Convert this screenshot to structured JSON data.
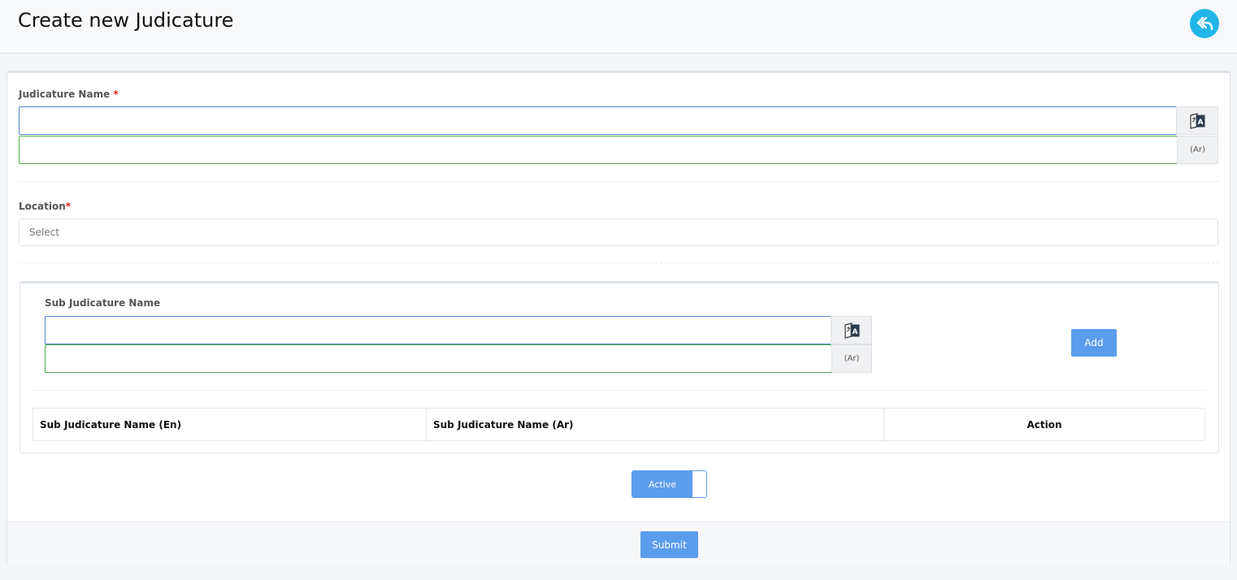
{
  "header": {
    "title": "Create new Judicature"
  },
  "form": {
    "judicature_name_label": "Judicature Name",
    "required_mark": "*",
    "name_en_value": "",
    "name_ar_value": "",
    "ar_addon": "(Ar)",
    "location_label": "Location",
    "location_placeholder": "Select",
    "sub": {
      "label": "Sub Judicature Name",
      "en_value": "",
      "ar_value": "",
      "ar_addon": "(Ar)",
      "add_label": "Add",
      "table_headers": [
        "Sub Judicature Name (En)",
        "Sub Judicature Name (Ar)",
        "Action"
      ]
    },
    "active_label": "Active",
    "submit_label": "Submit"
  },
  "colors": {
    "primary": "#5b9ded",
    "back_button": "#21b5e8",
    "valid_border": "#4cb04c",
    "focus_border": "#4c86e0",
    "required": "#e02020"
  },
  "icons": {
    "back": "reply-all-icon",
    "translate": "translate-icon"
  }
}
